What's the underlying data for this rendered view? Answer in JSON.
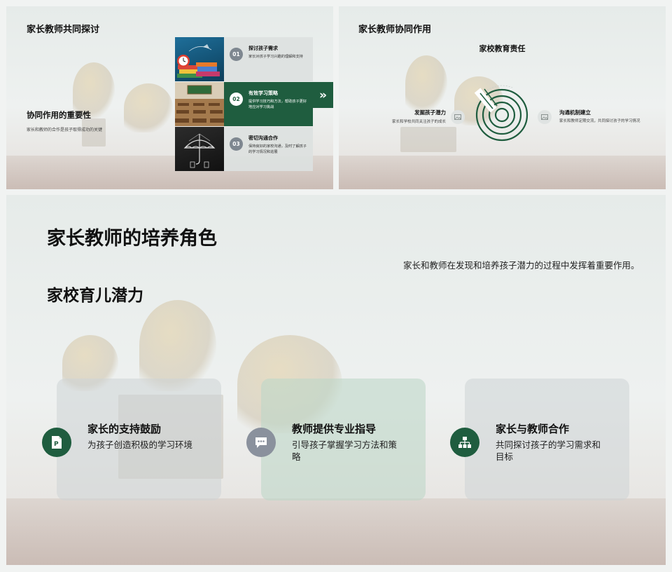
{
  "slide1": {
    "title": "家长教师共同探讨",
    "subtitle": "协同作用的重要性",
    "description": "家长和教师的合作是孩子取得成功的关键",
    "items": [
      {
        "num": "01",
        "heading": "探讨孩子需求",
        "text": "家长对孩子学习兴趣的理解和支持",
        "image_icon": "books-clock-image"
      },
      {
        "num": "02",
        "heading": "有效学习策略",
        "text": "提供学习技巧和方法，帮助孩子更好地应对学习挑战",
        "image_icon": "classroom-image"
      },
      {
        "num": "03",
        "heading": "密切沟通合作",
        "text": "保持良好的家校沟通，及时了解孩子的学习情况和进展",
        "image_icon": "umbrella-chalk-image"
      }
    ],
    "arrow_glyph": "»"
  },
  "slide2": {
    "title": "家长教师协同作用",
    "center_title": "家校教育责任",
    "left": {
      "heading": "发掘孩子潜力",
      "text": "家长和学校共同关注孩子的成长",
      "icon": "image-icon"
    },
    "right": {
      "heading": "沟通机制建立",
      "text": "家长和教师定期交流，共同探讨孩子的学习情况",
      "icon": "image-icon"
    },
    "accent": "#1f5d3f"
  },
  "slide3": {
    "title": "家长教师的培养角色",
    "subtitle": "家校育儿潜力",
    "right_text": "家长和教师在发现和培养孩子潜力的过程中发挥着重要作用。",
    "cards": [
      {
        "heading": "家长的支持鼓励",
        "text": "为孩子创造积极的学习环境",
        "icon": "document-p-icon",
        "icon_color": "#1f5d3f"
      },
      {
        "heading": "教师提供专业指导",
        "text": "引导孩子掌握学习方法和策略",
        "icon": "chat-bubble-icon",
        "icon_color": "#8a919d"
      },
      {
        "heading": "家长与教师合作",
        "text": "共同探讨孩子的学习需求和目标",
        "icon": "org-chart-icon",
        "icon_color": "#1f5d3f"
      }
    ]
  }
}
